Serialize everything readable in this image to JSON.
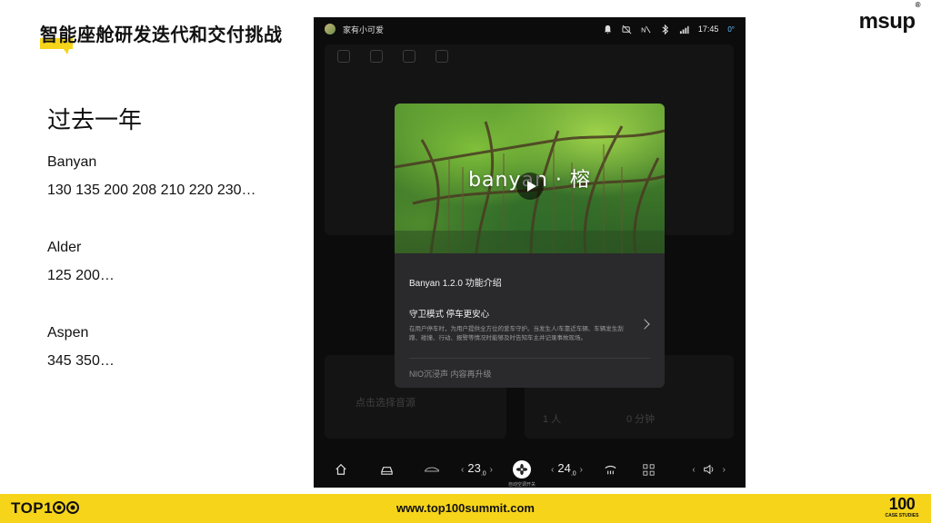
{
  "slide": {
    "title": "智能座舱研发迭代和交付挑战",
    "brand_logo": "msup",
    "brand_logo_mark": "®"
  },
  "content": {
    "heading": "过去一年",
    "groups": [
      {
        "name": "Banyan",
        "values": "130 135 200 208 210 220 230…"
      },
      {
        "name": "Alder",
        "values": "125 200…"
      },
      {
        "name": "Aspen",
        "values": "345 350…"
      }
    ]
  },
  "screen": {
    "status": {
      "user_name": "家有小可爱",
      "time": "17:45",
      "temperature": "0°",
      "icons": [
        "bell-icon",
        "mute-icon",
        "nfc-icon",
        "bluetooth-icon",
        "signal-icon"
      ]
    },
    "background_labels": [
      "点击选择音源",
      "1 人",
      "0 分钟"
    ],
    "modal": {
      "hero_brand": "banyan · 榕",
      "title": "Banyan 1.2.0 功能介绍",
      "feature1_title": "守卫模式 停车更安心",
      "feature1_desc": "在用户停车时，为用户提供全方位的爱车守护。当发生人/车靠近车辆、车辆发生刮蹭、碰撞、行动、报警等情况时能够及时告知车主并记录事故现场。",
      "feature2_title": "NIO沉浸声 内容再升级"
    },
    "dock": {
      "left_temp": "23",
      "left_temp_decimal": ".0",
      "right_temp": "24",
      "right_temp_decimal": ".0",
      "fan_label": "自动空调开关",
      "icons": [
        "home-icon",
        "car-icon",
        "car-side-icon",
        "fan-icon",
        "defrost-icon",
        "apps-icon",
        "volume-icon"
      ]
    }
  },
  "footer": {
    "left_logo": "TOP1",
    "url": "www.top100summit.com",
    "right_logo_big": "100",
    "right_logo_small": "CASE STUDIES"
  },
  "colors": {
    "footer_bg": "#f6d41a",
    "screen_bg": "#0c0c0c",
    "modal_bg": "#2a2a2c",
    "accent_temp": "#5fc2ff"
  }
}
